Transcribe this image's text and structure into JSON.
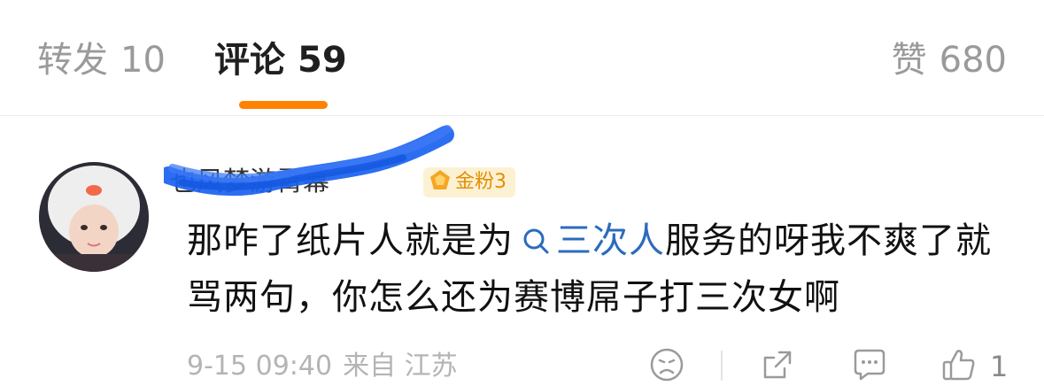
{
  "tabs": {
    "repost": {
      "label": "转发",
      "count": "10"
    },
    "comment": {
      "label": "评论",
      "count": "59"
    },
    "like": {
      "label": "赞",
      "count": "680"
    }
  },
  "comment": {
    "username": "也风梦游霄幕",
    "badge": "金粉3",
    "text_before": "那咋了纸片人就是为",
    "topic": "三次人",
    "text_after": "服务的呀我不爽了就骂两句，你怎么还为赛博屌子打三次女啊",
    "date": "9-15 09:40",
    "source": "来自 江苏",
    "like_count": "1"
  },
  "colors": {
    "accent": "#ff8200",
    "topic_link": "#2b6bbd",
    "badge_text": "#e28f00",
    "scribble": "#1a62f0"
  },
  "icons": [
    "search-icon",
    "gem-icon",
    "dislike-face-icon",
    "share-icon",
    "comment-icon",
    "thumbs-up-icon"
  ]
}
